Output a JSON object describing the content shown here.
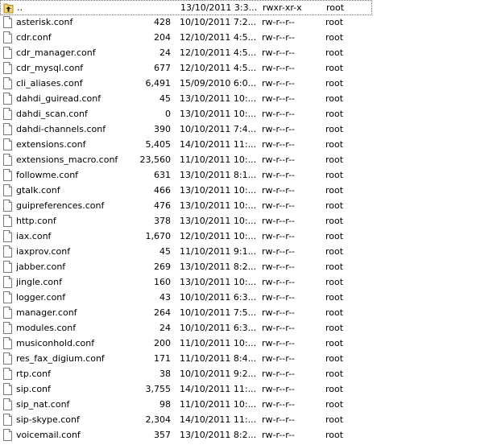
{
  "files": [
    {
      "name": "..",
      "size": "",
      "date": "13/10/2011 3:3...",
      "perms": "rwxr-xr-x",
      "owner": "root",
      "icon": "parent-folder-icon"
    },
    {
      "name": "asterisk.conf",
      "size": "428",
      "date": "10/10/2011 7:2...",
      "perms": "rw-r--r--",
      "owner": "root",
      "icon": "file-icon"
    },
    {
      "name": "cdr.conf",
      "size": "204",
      "date": "12/10/2011 4:5...",
      "perms": "rw-r--r--",
      "owner": "root",
      "icon": "file-icon"
    },
    {
      "name": "cdr_manager.conf",
      "size": "24",
      "date": "12/10/2011 4:5...",
      "perms": "rw-r--r--",
      "owner": "root",
      "icon": "file-icon"
    },
    {
      "name": "cdr_mysql.conf",
      "size": "677",
      "date": "12/10/2011 4:5...",
      "perms": "rw-r--r--",
      "owner": "root",
      "icon": "file-icon"
    },
    {
      "name": "cli_aliases.conf",
      "size": "6,491",
      "date": "15/09/2010 6:0...",
      "perms": "rw-r--r--",
      "owner": "root",
      "icon": "file-icon"
    },
    {
      "name": "dahdi_guiread.conf",
      "size": "45",
      "date": "13/10/2011 10:...",
      "perms": "rw-r--r--",
      "owner": "root",
      "icon": "file-icon"
    },
    {
      "name": "dahdi_scan.conf",
      "size": "0",
      "date": "13/10/2011 10:...",
      "perms": "rw-r--r--",
      "owner": "root",
      "icon": "file-icon"
    },
    {
      "name": "dahdi-channels.conf",
      "size": "390",
      "date": "10/10/2011 7:4...",
      "perms": "rw-r--r--",
      "owner": "root",
      "icon": "file-icon"
    },
    {
      "name": "extensions.conf",
      "size": "5,405",
      "date": "14/10/2011 11:...",
      "perms": "rw-r--r--",
      "owner": "root",
      "icon": "file-icon"
    },
    {
      "name": "extensions_macro.conf",
      "size": "23,560",
      "date": "11/10/2011 10:...",
      "perms": "rw-r--r--",
      "owner": "root",
      "icon": "file-icon"
    },
    {
      "name": "followme.conf",
      "size": "631",
      "date": "13/10/2011 8:1...",
      "perms": "rw-r--r--",
      "owner": "root",
      "icon": "file-icon"
    },
    {
      "name": "gtalk.conf",
      "size": "466",
      "date": "13/10/2011 10:...",
      "perms": "rw-r--r--",
      "owner": "root",
      "icon": "file-icon"
    },
    {
      "name": "guipreferences.conf",
      "size": "476",
      "date": "13/10/2011 10:...",
      "perms": "rw-r--r--",
      "owner": "root",
      "icon": "file-icon"
    },
    {
      "name": "http.conf",
      "size": "378",
      "date": "13/10/2011 10:...",
      "perms": "rw-r--r--",
      "owner": "root",
      "icon": "file-icon"
    },
    {
      "name": "iax.conf",
      "size": "1,670",
      "date": "12/10/2011 10:...",
      "perms": "rw-r--r--",
      "owner": "root",
      "icon": "file-icon"
    },
    {
      "name": "iaxprov.conf",
      "size": "45",
      "date": "11/10/2011 9:1...",
      "perms": "rw-r--r--",
      "owner": "root",
      "icon": "file-icon"
    },
    {
      "name": "jabber.conf",
      "size": "269",
      "date": "13/10/2011 8:2...",
      "perms": "rw-r--r--",
      "owner": "root",
      "icon": "file-icon"
    },
    {
      "name": "jingle.conf",
      "size": "160",
      "date": "13/10/2011 10:...",
      "perms": "rw-r--r--",
      "owner": "root",
      "icon": "file-icon"
    },
    {
      "name": "logger.conf",
      "size": "43",
      "date": "10/10/2011 6:3...",
      "perms": "rw-r--r--",
      "owner": "root",
      "icon": "file-icon"
    },
    {
      "name": "manager.conf",
      "size": "264",
      "date": "10/10/2011 7:5...",
      "perms": "rw-r--r--",
      "owner": "root",
      "icon": "file-icon"
    },
    {
      "name": "modules.conf",
      "size": "24",
      "date": "10/10/2011 6:3...",
      "perms": "rw-r--r--",
      "owner": "root",
      "icon": "file-icon"
    },
    {
      "name": "musiconhold.conf",
      "size": "200",
      "date": "11/10/2011 10:...",
      "perms": "rw-r--r--",
      "owner": "root",
      "icon": "file-icon"
    },
    {
      "name": "res_fax_digium.conf",
      "size": "171",
      "date": "11/10/2011 8:4...",
      "perms": "rw-r--r--",
      "owner": "root",
      "icon": "file-icon"
    },
    {
      "name": "rtp.conf",
      "size": "38",
      "date": "10/10/2011 9:2...",
      "perms": "rw-r--r--",
      "owner": "root",
      "icon": "file-icon"
    },
    {
      "name": "sip.conf",
      "size": "3,755",
      "date": "14/10/2011 11:...",
      "perms": "rw-r--r--",
      "owner": "root",
      "icon": "file-icon"
    },
    {
      "name": "sip_nat.conf",
      "size": "98",
      "date": "11/10/2011 10:...",
      "perms": "rw-r--r--",
      "owner": "root",
      "icon": "file-icon"
    },
    {
      "name": "sip-skype.conf",
      "size": "2,304",
      "date": "14/10/2011 11:...",
      "perms": "rw-r--r--",
      "owner": "root",
      "icon": "file-icon"
    },
    {
      "name": "voicemail.conf",
      "size": "357",
      "date": "13/10/2011 8:2...",
      "perms": "rw-r--r--",
      "owner": "root",
      "icon": "file-icon"
    }
  ],
  "colors": {
    "text": "#000000",
    "background": "#ffffff",
    "focus_border": "#6e6e6e",
    "icon_outline": "#7a7a7a",
    "folder_fill": "#f5d36b",
    "arrow": "#1d1d1d"
  }
}
